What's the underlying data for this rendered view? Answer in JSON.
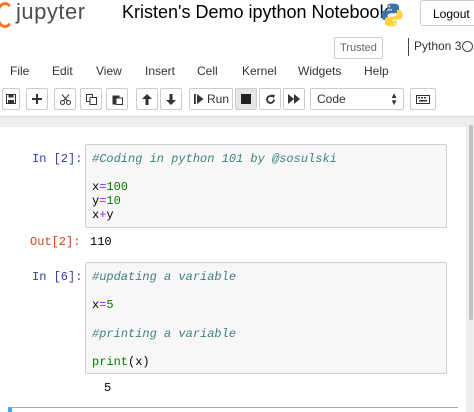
{
  "header": {
    "logo_text": "jupyter",
    "notebook_title": "Kristen's Demo ipython Notebook",
    "logout_label": "Logout"
  },
  "status": {
    "trusted_label": "Trusted",
    "kernel_name": "Python 3"
  },
  "menubar": {
    "items": [
      "File",
      "Edit",
      "View",
      "Insert",
      "Cell",
      "Kernel",
      "Widgets",
      "Help"
    ]
  },
  "toolbar": {
    "buttons": [
      "save-icon",
      "add-cell-icon",
      "cut-icon",
      "copy-icon",
      "paste-icon",
      "move-up-icon",
      "move-down-icon",
      "run-icon",
      "stop-icon",
      "restart-icon",
      "fast-forward-icon",
      "keyboard-icon"
    ],
    "run_label": "Run",
    "cell_type_selected": "Code"
  },
  "cells": [
    {
      "prompt": "In [2]:",
      "code": [
        "#Coding in python 101 by @sosulski",
        "",
        "x=100",
        "y=10",
        "x+y"
      ],
      "output_prompt": "Out[2]:",
      "output": "110"
    },
    {
      "prompt": "In [6]:",
      "code": [
        "#updating a variable",
        "",
        "x=5",
        "",
        "#printing a variable",
        "",
        "print(x)"
      ],
      "output": "5"
    }
  ],
  "colors": {
    "prompt_in": "#303f9f",
    "prompt_out": "#d84315",
    "comment": "#408080",
    "operator": "#aa22ff",
    "number": "#008000",
    "logo_orange": "#f37726"
  }
}
